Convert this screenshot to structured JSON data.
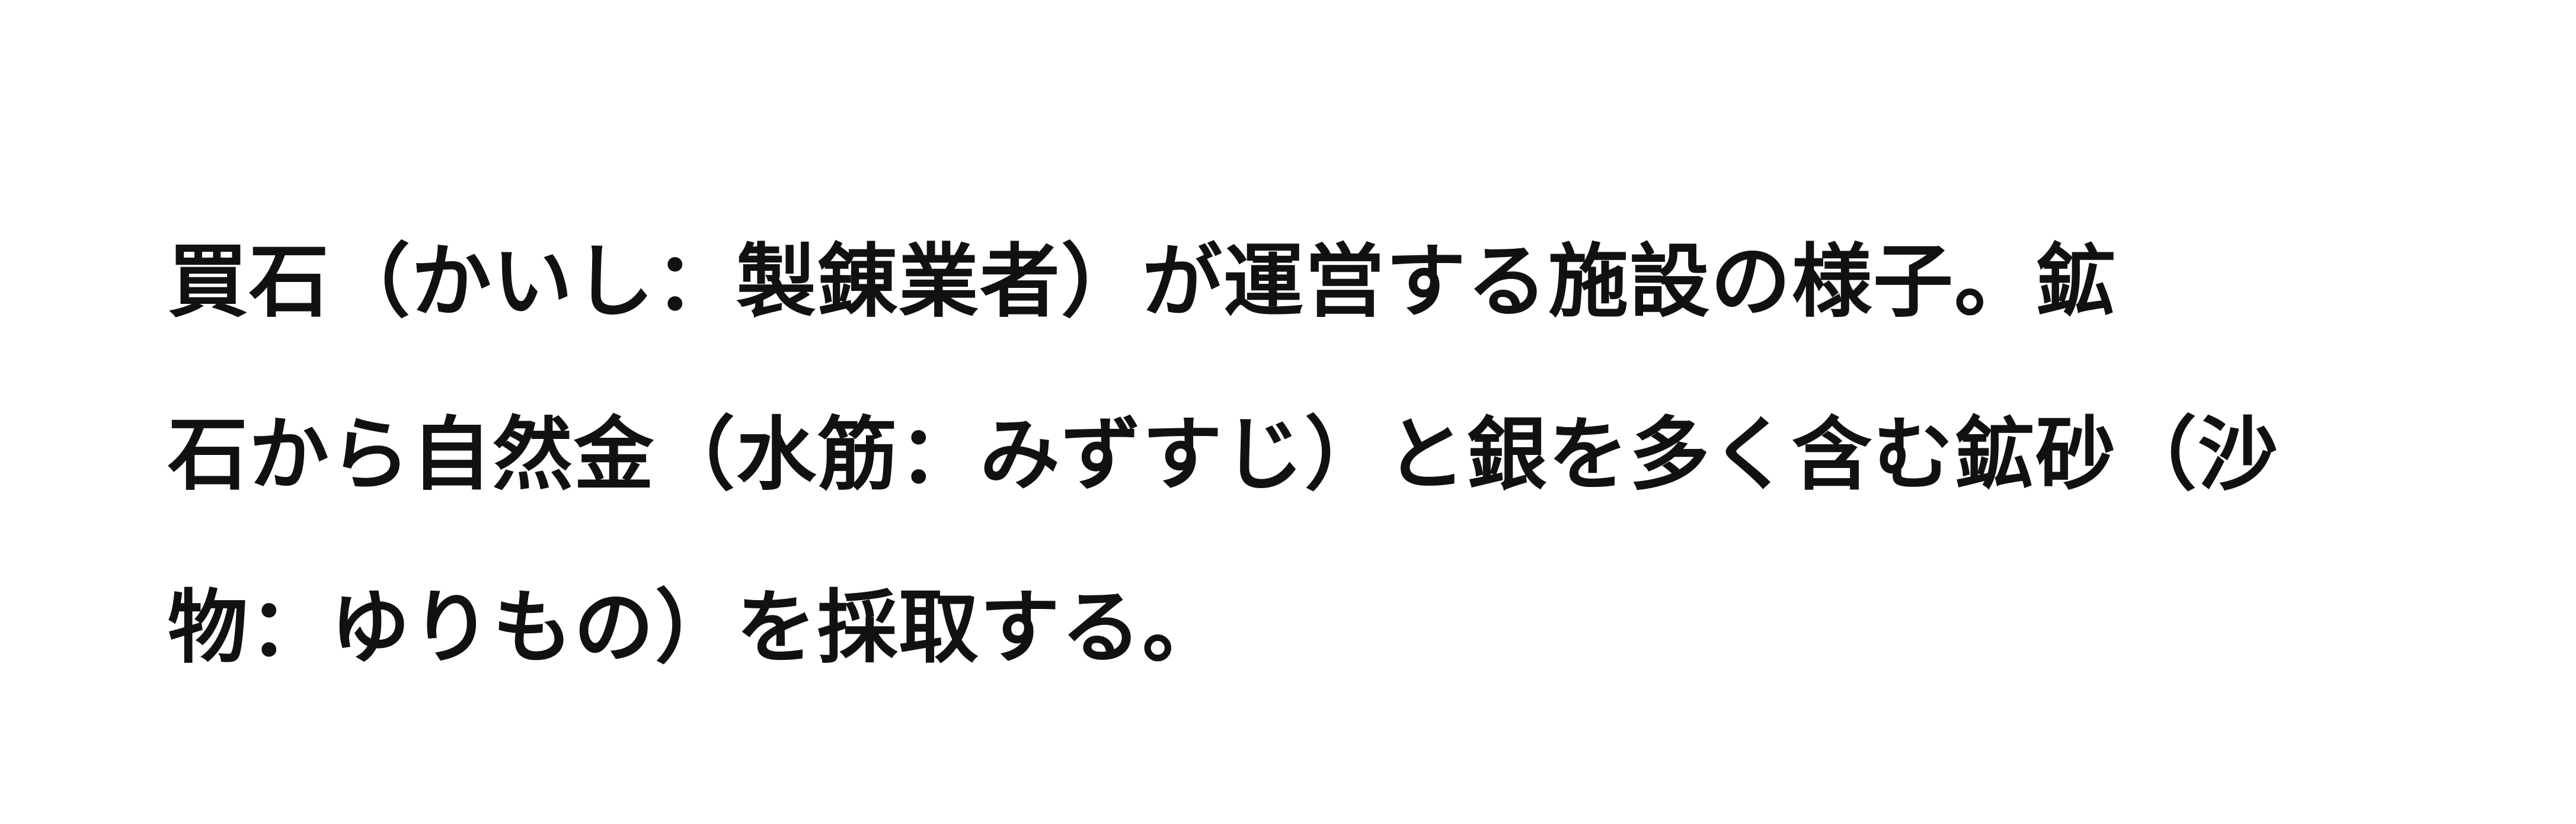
{
  "caption": {
    "lines": [
      "買石（かいし：製錬業者）が運営する施設の様子。鉱",
      "石から自然金（水筋：みずすじ）と銀を多く含む鉱砂（沙",
      "物：ゆりもの）を採取する。"
    ]
  },
  "colors": {
    "background": "#ffffff",
    "text": "#111111"
  }
}
